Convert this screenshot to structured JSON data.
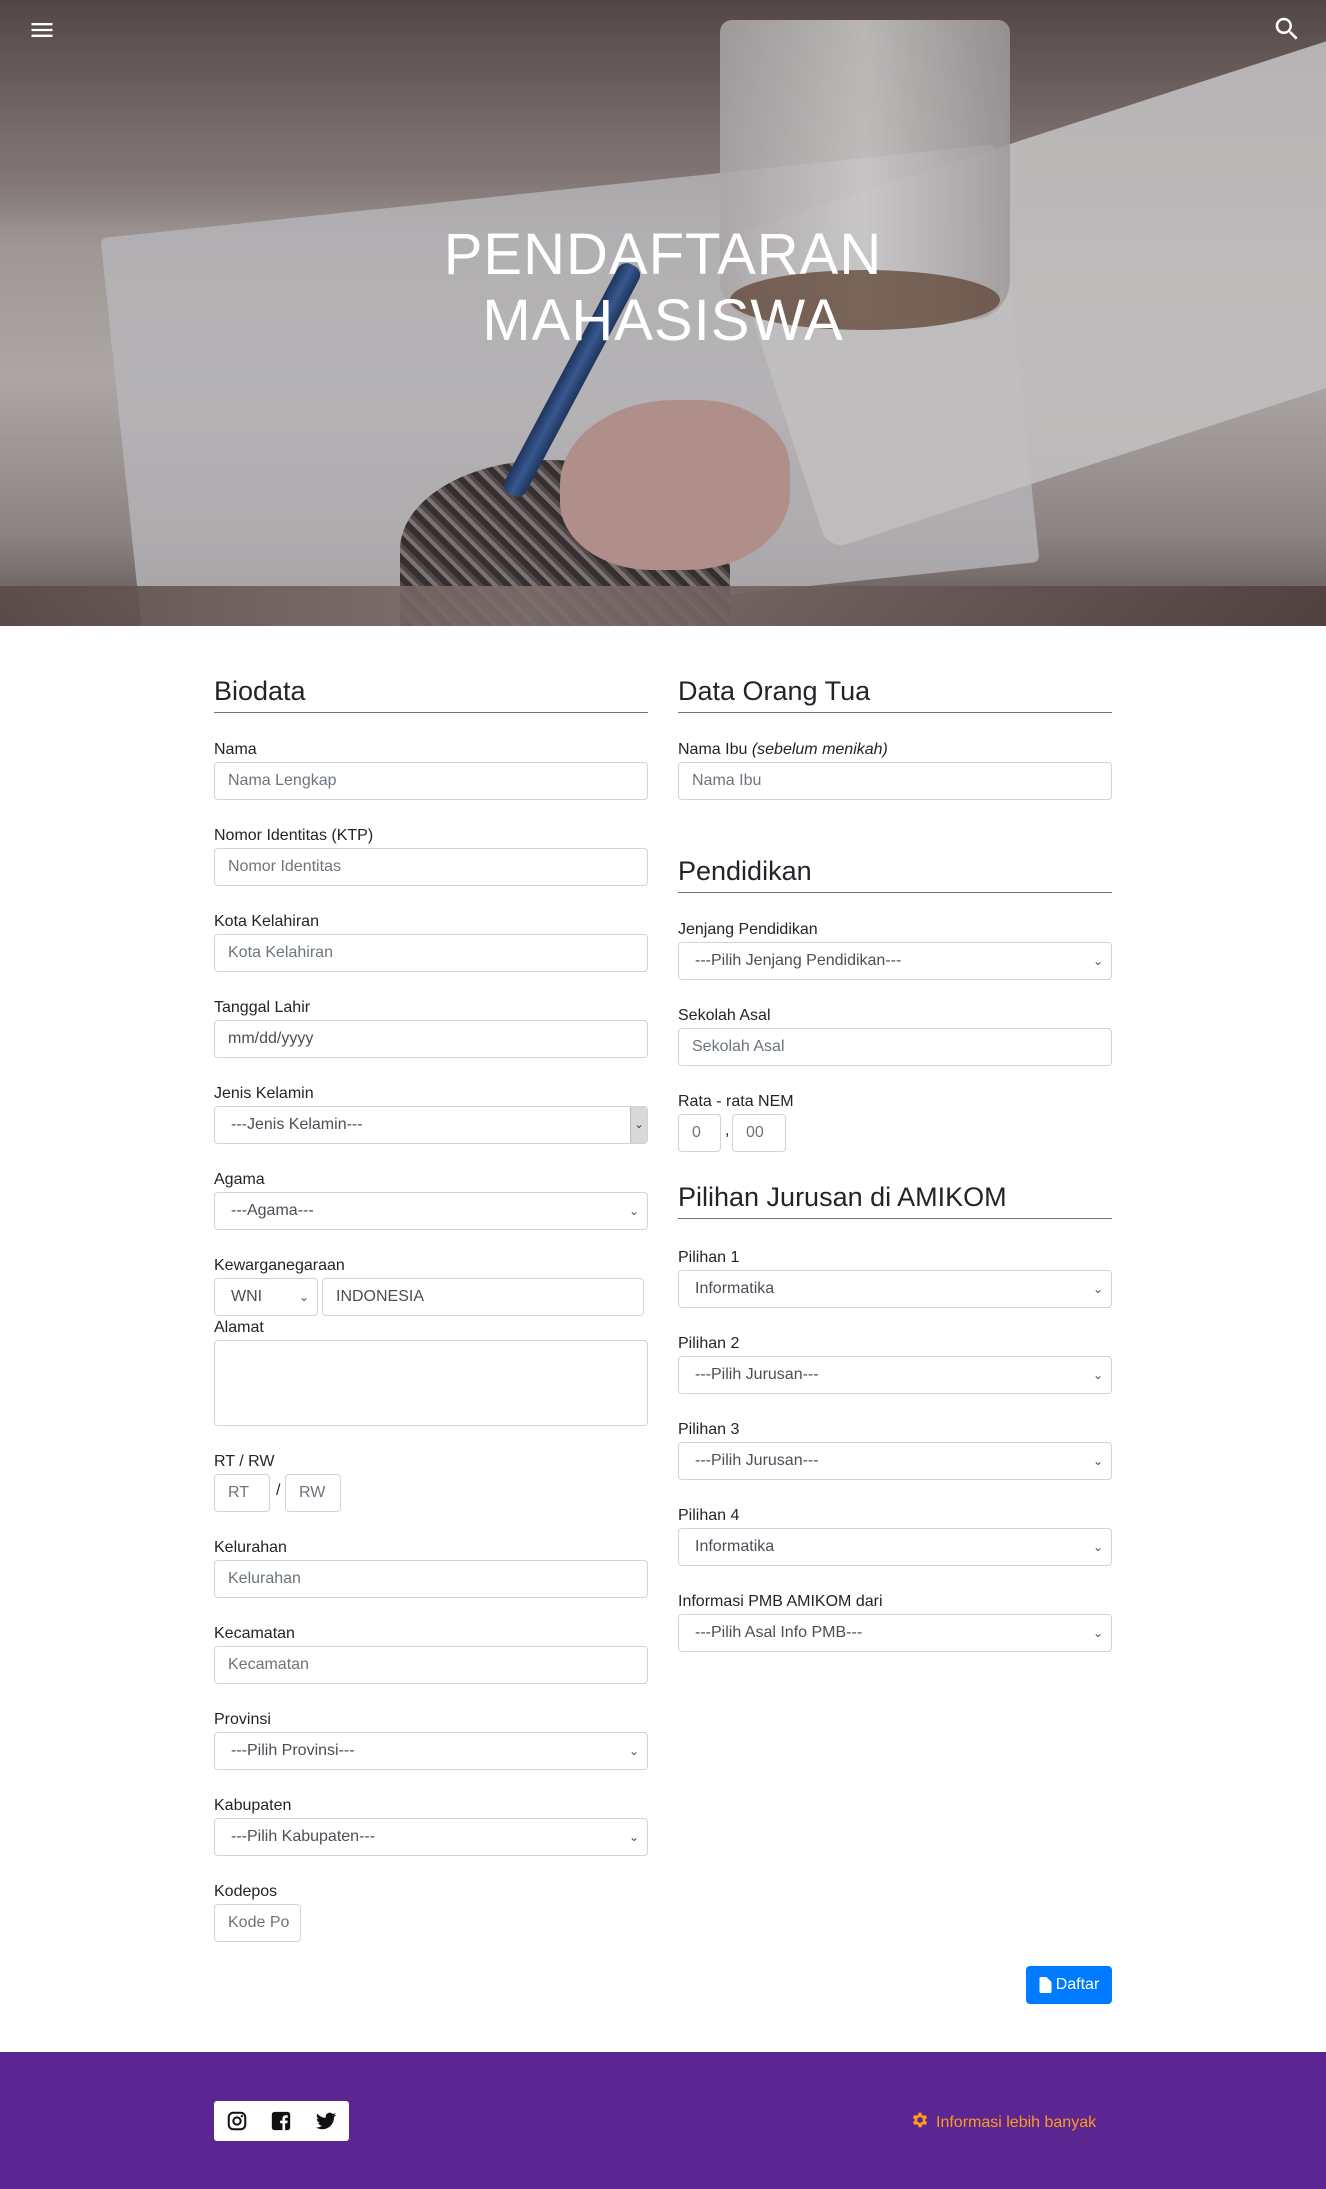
{
  "hero": {
    "title_line1": "PENDAFTARAN",
    "title_line2": "MAHASISWA"
  },
  "biodata": {
    "title": "Biodata",
    "nama_label": "Nama",
    "nama_placeholder": "Nama Lengkap",
    "ktp_label": "Nomor Identitas (KTP)",
    "ktp_placeholder": "Nomor Identitas",
    "kota_label": "Kota Kelahiran",
    "kota_placeholder": "Kota Kelahiran",
    "tgl_label": "Tanggal Lahir",
    "tgl_placeholder": "mm/dd/yyyy",
    "jk_label": "Jenis Kelamin",
    "jk_selected": "---Jenis Kelamin---",
    "agama_label": "Agama",
    "agama_selected": "---Agama---",
    "kw_label": "Kewarganegaraan",
    "kw_selected": "WNI",
    "kw_value": "INDONESIA",
    "alamat_label": "Alamat",
    "rtrw_label": "RT / RW",
    "rt_placeholder": "RT",
    "rw_placeholder": "RW",
    "rtrw_sep": "/",
    "kel_label": "Kelurahan",
    "kel_placeholder": "Kelurahan",
    "kec_label": "Kecamatan",
    "kec_placeholder": "Kecamatan",
    "prov_label": "Provinsi",
    "prov_selected": "---Pilih Provinsi---",
    "kab_label": "Kabupaten",
    "kab_selected": "---Pilih Kabupaten---",
    "kodepos_label": "Kodepos",
    "kodepos_placeholder": "Kode Po"
  },
  "ortu": {
    "title": "Data Orang Tua",
    "ibu_label": "Nama Ibu",
    "ibu_label_note": "(sebelum menikah)",
    "ibu_placeholder": "Nama Ibu"
  },
  "pendidikan": {
    "title": "Pendidikan",
    "jenjang_label": "Jenjang Pendidikan",
    "jenjang_selected": "---Pilih Jenjang Pendidikan---",
    "sekolah_label": "Sekolah Asal",
    "sekolah_placeholder": "Sekolah Asal",
    "nem_label": "Rata - rata NEM",
    "nem_int_placeholder": "0",
    "nem_sep": ",",
    "nem_dec_placeholder": "00"
  },
  "jurusan": {
    "title": "Pilihan Jurusan di AMIKOM",
    "p1_label": "Pilihan 1",
    "p1_selected": "Informatika",
    "p2_label": "Pilihan 2",
    "p2_selected": "---Pilih Jurusan---",
    "p3_label": "Pilihan 3",
    "p3_selected": "---Pilih Jurusan---",
    "p4_label": "Pilihan 4",
    "p4_selected": "Informatika",
    "info_label": "Informasi PMB AMIKOM dari",
    "info_selected": "---Pilih Asal Info PMB---"
  },
  "submit_label": "Daftar",
  "footer": {
    "info_link": "Informasi lebih banyak"
  },
  "colors": {
    "primary": "#007bff",
    "footer_bg": "#5b2691",
    "footer_link": "#fd9a1c"
  },
  "icons": [
    "menu-icon",
    "search-icon",
    "file-icon",
    "instagram-icon",
    "facebook-icon",
    "twitter-icon",
    "gear-icon"
  ]
}
